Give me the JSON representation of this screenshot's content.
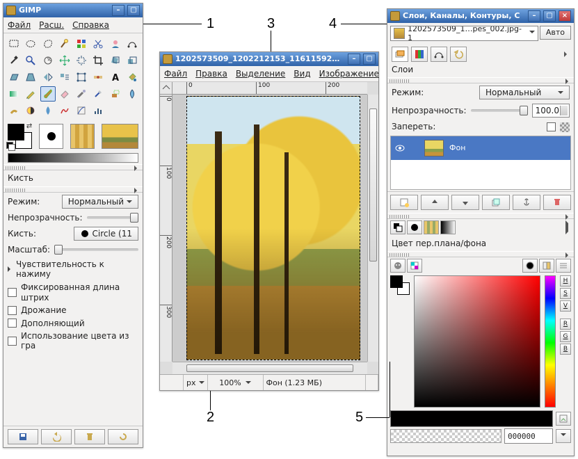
{
  "annotations": {
    "a1": "1",
    "a2": "2",
    "a3": "3",
    "a4": "4",
    "a5": "5"
  },
  "toolbox": {
    "title": "GIMP",
    "menu": {
      "file": "Файл",
      "ext": "Расш.",
      "help": "Справка"
    },
    "options_title": "Кисть",
    "mode_label": "Режим:",
    "mode_value": "Нормальный",
    "opacity_label": "Непрозрачность:",
    "brush_label": "Кисть:",
    "brush_value": "Circle (11",
    "scale_label": "Масштаб:",
    "pressure_label": "Чувствительность к нажиму",
    "fixedlen_label": "Фиксированная длина штрих",
    "jitter_label": "Дрожание",
    "incremental_label": "Дополняющий",
    "use_color_label": "Использование цвета из гра"
  },
  "imagewin": {
    "title": "1202573509_1202212153_11611592…",
    "menu": {
      "file": "Файл",
      "edit": "Правка",
      "select": "Выделение",
      "view": "Вид",
      "image": "Изображение"
    },
    "ruler_h": {
      "t0": "0",
      "t1": "100",
      "t2": "200"
    },
    "ruler_v": {
      "t0": "0",
      "t1": "100",
      "t2": "200",
      "t3": "300"
    },
    "status": {
      "unit": "px",
      "zoom": "100%",
      "info": "Фон (1.23 МБ)"
    }
  },
  "layerswin": {
    "title": "Слои, Каналы, Контуры, С",
    "auto": "Авто",
    "file_label": "1202573509_1…pes_002.jpg-1",
    "layers_tab_title": "Слои",
    "mode_label": "Режим:",
    "mode_value": "Нормальный",
    "opacity_label": "Непрозрачность:",
    "opacity_value": "100.0",
    "lock_label": "Запереть:",
    "layer_name": "Фон",
    "color_section_label": "Цвет пер.плана/фона",
    "channels": {
      "h": "H",
      "s": "S",
      "v": "V",
      "r": "R",
      "g": "G",
      "b": "B"
    },
    "hex_value": "000000"
  }
}
